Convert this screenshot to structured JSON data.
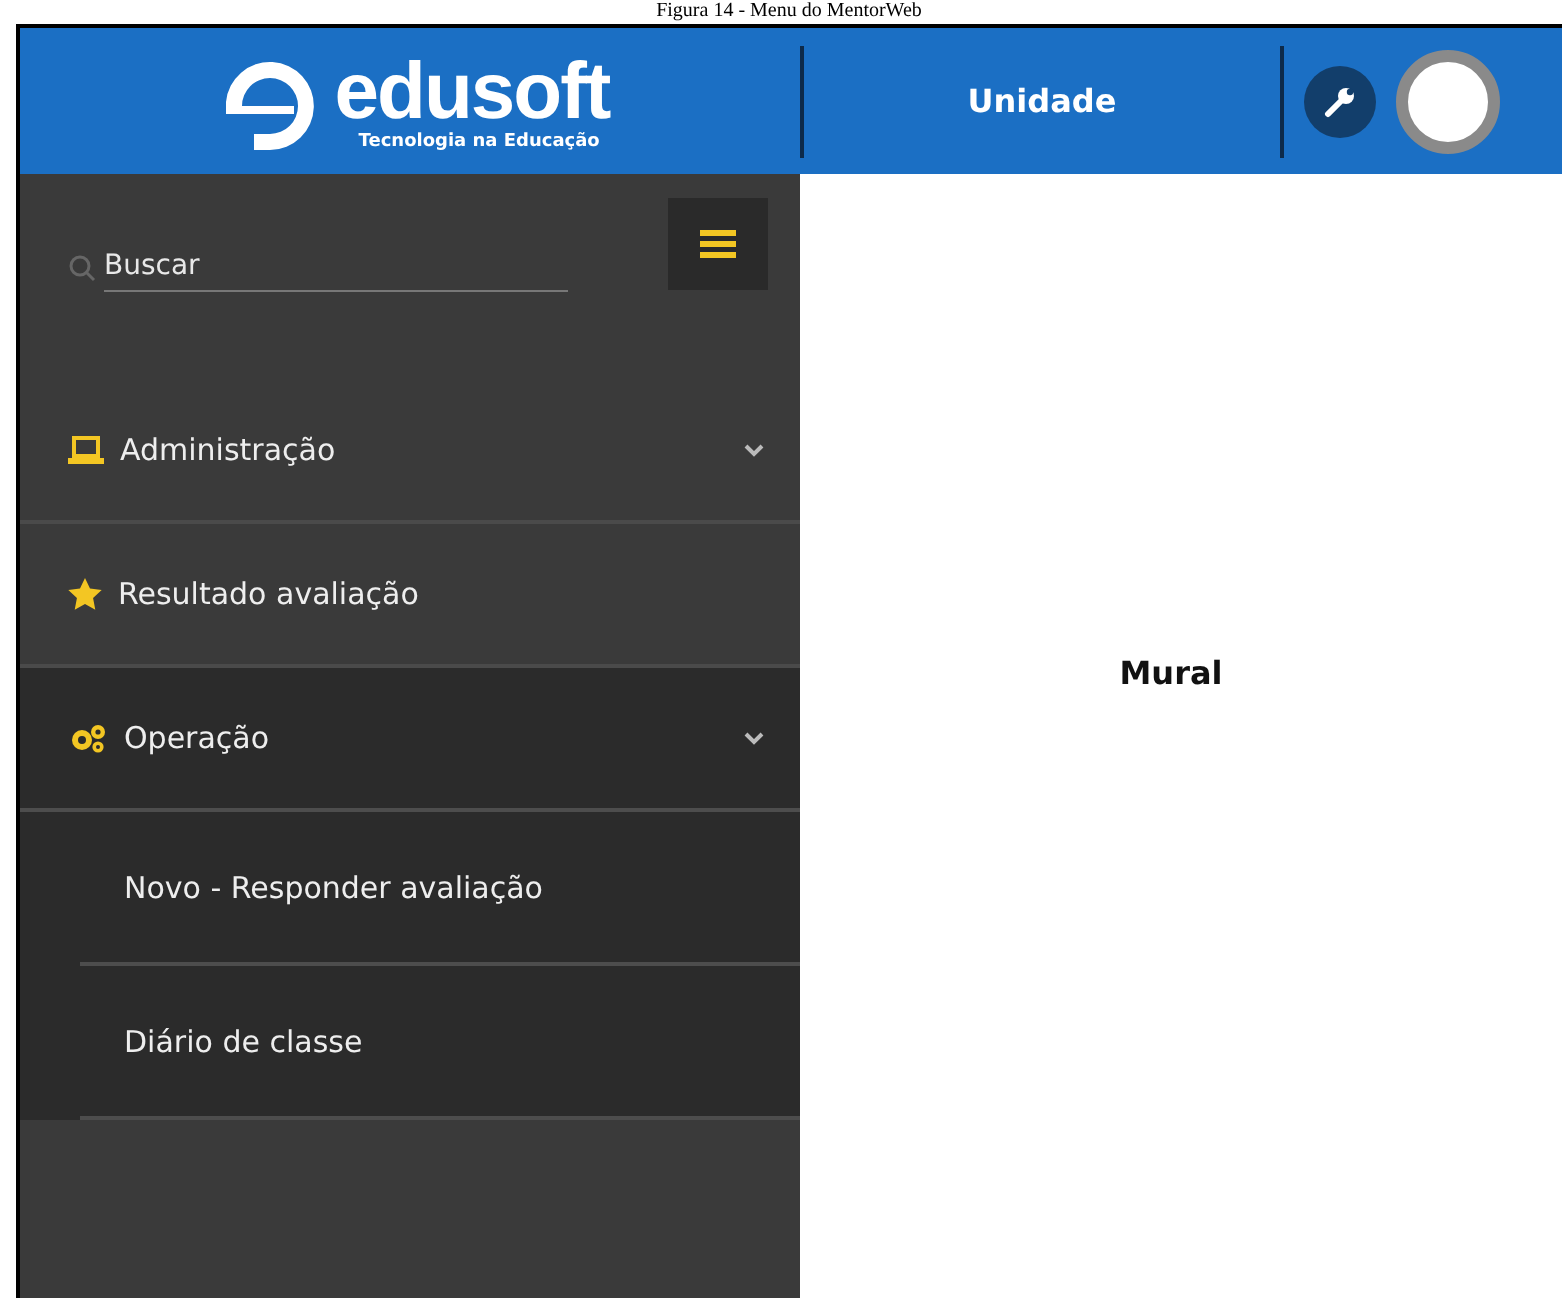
{
  "caption": "Figura 14 - Menu do MentorWeb",
  "header": {
    "logo_name": "edusoft",
    "logo_tagline": "Tecnologia na Educação",
    "unit": "Unidade"
  },
  "sidebar": {
    "search": {
      "placeholder": "Buscar"
    },
    "items": [
      {
        "label": "Administração",
        "kind": "laptop",
        "expanded": false
      },
      {
        "label": "Resultado avaliação",
        "kind": "star"
      },
      {
        "label": "Operação",
        "kind": "gears",
        "expanded": true,
        "children": [
          {
            "label": "Novo - Responder avaliação"
          },
          {
            "label": "Diário de classe"
          }
        ]
      }
    ]
  },
  "main": {
    "title": "Mural"
  }
}
